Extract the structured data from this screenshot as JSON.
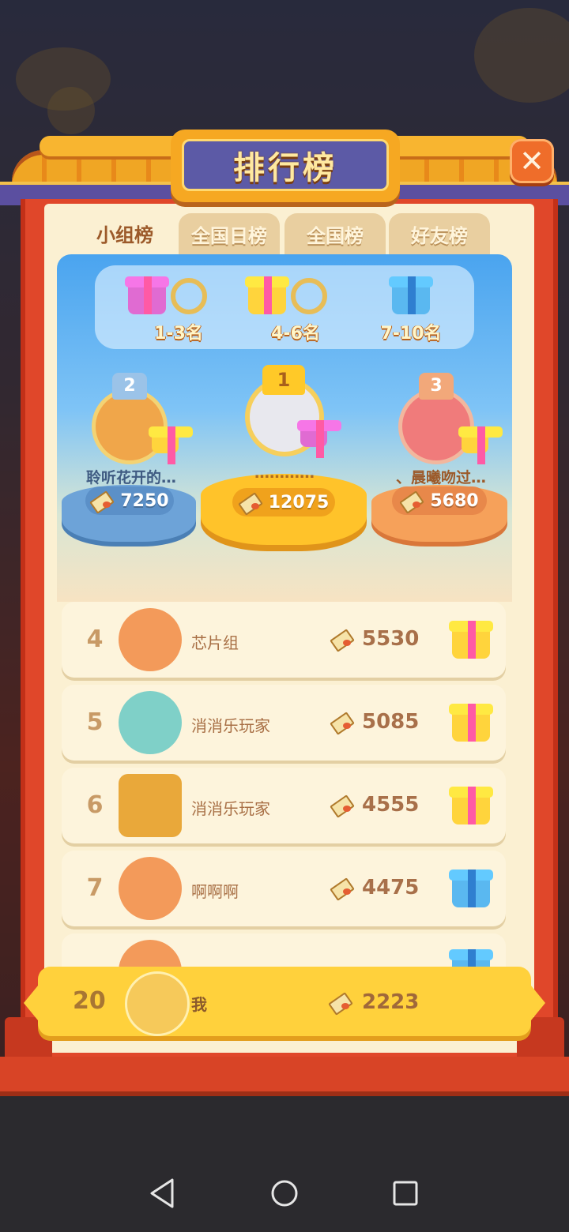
{
  "title": "排行榜",
  "tabs": [
    {
      "label": "小组榜",
      "active": true
    },
    {
      "label": "全国日榜",
      "active": false
    },
    {
      "label": "全国榜",
      "active": false
    },
    {
      "label": "好友榜",
      "active": false
    }
  ],
  "rewards": [
    {
      "label": "1-3名",
      "gift": "pink-gift-icon"
    },
    {
      "label": "4-6名",
      "gift": "yellow-gift-icon"
    },
    {
      "label": "7-10名",
      "gift": "blue-gift-icon"
    }
  ],
  "podium": [
    {
      "rank": "2",
      "name": "聆听花开的…",
      "score": "7250"
    },
    {
      "rank": "1",
      "name": "…………",
      "score": "12075"
    },
    {
      "rank": "3",
      "name": "、晨曦吻过…",
      "score": "5680"
    }
  ],
  "list": [
    {
      "rank": "4",
      "name": "芯片组",
      "score": "5530",
      "gift": "yellow-gift-icon"
    },
    {
      "rank": "5",
      "name": "消消乐玩家",
      "score": "5085",
      "gift": "yellow-gift-icon"
    },
    {
      "rank": "6",
      "name": "消消乐玩家",
      "score": "4555",
      "gift": "yellow-gift-icon"
    },
    {
      "rank": "7",
      "name": "啊啊啊",
      "score": "4475",
      "gift": "blue-gift-icon"
    }
  ],
  "self": {
    "rank": "20",
    "name": "我",
    "score": "2223"
  },
  "colors": {
    "frame": "#e0472a",
    "panel_bg": "#fbf0d2",
    "accent": "#ffd13c",
    "title_plaque": "#5c5aa6"
  }
}
